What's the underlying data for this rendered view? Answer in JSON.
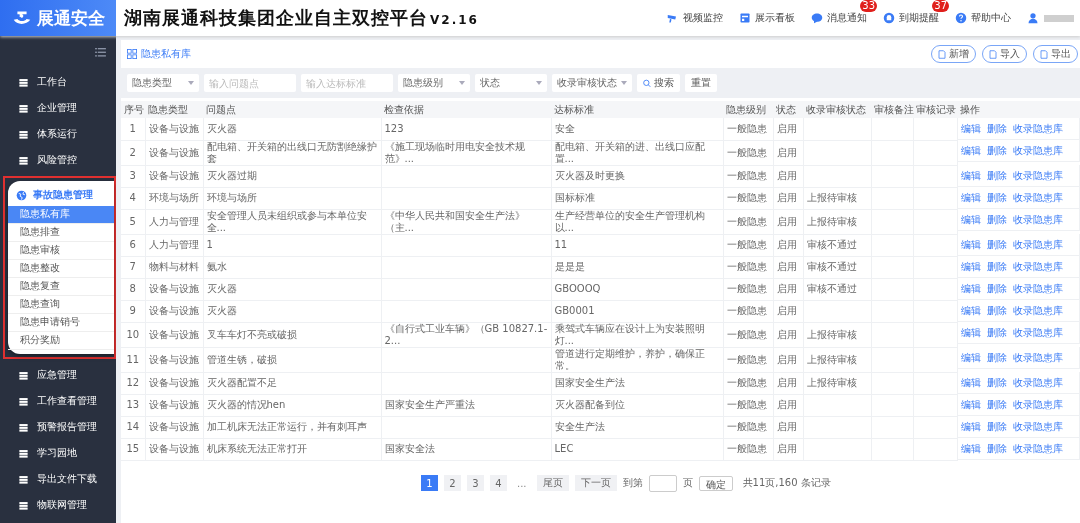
{
  "logo": {
    "text": "展通安全"
  },
  "header": {
    "title": "湖南展通科技集团企业自主双控平台",
    "version": "V2.16",
    "nav": [
      {
        "label": "视频监控"
      },
      {
        "label": "展示看板"
      },
      {
        "label": "消息通知",
        "badge": "33"
      },
      {
        "label": "到期提醒",
        "badge": "37"
      },
      {
        "label": "帮助中心"
      }
    ]
  },
  "sidebar": {
    "items": [
      {
        "label": "工作台"
      },
      {
        "label": "企业管理"
      },
      {
        "label": "体系运行"
      },
      {
        "label": "风险管控"
      },
      {
        "label": "事故隐患管理",
        "expanded": true,
        "children": [
          {
            "label": "隐患私有库",
            "selected": true
          },
          {
            "label": "隐患排查",
            "selected": false
          },
          {
            "label": "隐患审核",
            "selected": false
          },
          {
            "label": "隐患整改",
            "selected": false
          },
          {
            "label": "隐患复查",
            "selected": false
          },
          {
            "label": "隐患查询",
            "selected": false
          },
          {
            "label": "隐患申请销号",
            "selected": false
          },
          {
            "label": "积分奖励",
            "selected": false
          }
        ]
      },
      {
        "label": "应急管理"
      },
      {
        "label": "工作查看管理"
      },
      {
        "label": "预警报告管理"
      },
      {
        "label": "学习园地"
      },
      {
        "label": "导出文件下载"
      },
      {
        "label": "物联网管理"
      }
    ]
  },
  "page": {
    "title": "隐患私有库",
    "buttons": [
      "新增",
      "导入",
      "导出"
    ]
  },
  "filters": [
    {
      "kind": "select",
      "placeholder": "隐患类型"
    },
    {
      "kind": "input",
      "placeholder": "输入问题点"
    },
    {
      "kind": "input",
      "placeholder": "输入达标标准"
    },
    {
      "kind": "select",
      "placeholder": "隐患级别"
    },
    {
      "kind": "select",
      "placeholder": "状态"
    },
    {
      "kind": "select",
      "placeholder": "收录审核状态"
    }
  ],
  "search_button": "搜索",
  "reset_button": "重置",
  "table": {
    "columns": [
      "序号",
      "隐患类型",
      "问题点",
      "检查依据",
      "达标标准",
      "隐患级别",
      "状态",
      "收录审核状态",
      "审核备注",
      "审核记录",
      "操作"
    ],
    "rows": [
      {
        "no": "1",
        "type": "设备与设施",
        "issue": "灭火器",
        "basis": "123",
        "standard": "安全",
        "level": "一般隐患",
        "status": "启用",
        "actions": [
          "编辑",
          "删除",
          "收录隐患库"
        ]
      },
      {
        "no": "2",
        "type": "设备与设施",
        "issue": "配电箱、开关箱的出线口无防割绝缘护套",
        "basis": "《施工现场临时用电安全技术规范》...",
        "standard": "配电箱、开关箱的进、出线口应配置...",
        "level": "一般隐患",
        "status": "启用",
        "actions": [
          "编辑",
          "删除",
          "收录隐患库"
        ]
      },
      {
        "no": "3",
        "type": "设备与设施",
        "issue": "灭火器过期",
        "standard": "灭火器及时更换",
        "level": "一般隐患",
        "status": "启用",
        "actions": [
          "编辑",
          "删除",
          "收录隐患库"
        ]
      },
      {
        "no": "4",
        "type": "环境与场所",
        "issue": "环境与场所",
        "standard": "国标标准",
        "level": "一般隐患",
        "status": "启用",
        "review": "上报待审核",
        "actions": [
          "编辑",
          "删除",
          "收录隐患库"
        ]
      },
      {
        "no": "5",
        "type": "人力与管理",
        "issue": "安全管理人员未组织或参与本单位安全...",
        "basis": "《中华人民共和国安全生产法》（主...",
        "standard": "生产经营单位的安全生产管理机构以...",
        "level": "一般隐患",
        "status": "启用",
        "review": "上报待审核",
        "actions": [
          "编辑",
          "删除",
          "收录隐患库"
        ]
      },
      {
        "no": "6",
        "type": "人力与管理",
        "issue": "1",
        "standard": "11",
        "level": "一般隐患",
        "status": "启用",
        "review": "审核不通过",
        "actions": [
          "编辑",
          "删除",
          "收录隐患库"
        ]
      },
      {
        "no": "7",
        "type": "物料与材料",
        "issue": "氨水",
        "standard": "是是是",
        "level": "一般隐患",
        "status": "启用",
        "review": "审核不通过",
        "actions": [
          "编辑",
          "删除",
          "收录隐患库"
        ]
      },
      {
        "no": "8",
        "type": "设备与设施",
        "issue": "灭火器",
        "standard": "GBOOOQ",
        "level": "一般隐患",
        "status": "启用",
        "review": "审核不通过",
        "actions": [
          "编辑",
          "删除",
          "收录隐患库"
        ]
      },
      {
        "no": "9",
        "type": "设备与设施",
        "issue": "灭火器",
        "standard": "GB0001",
        "level": "一般隐患",
        "status": "启用",
        "actions": [
          "编辑",
          "删除",
          "收录隐患库"
        ]
      },
      {
        "no": "10",
        "type": "设备与设施",
        "issue": "叉车车灯不亮或破损",
        "basis": "《自行式工业车辆》（GB 10827.1-2...",
        "standard": "乘驾式车辆应在设计上为安装照明灯...",
        "level": "一般隐患",
        "status": "启用",
        "review": "上报待审核",
        "actions": [
          "编辑",
          "删除",
          "收录隐患库"
        ]
      },
      {
        "no": "11",
        "type": "设备与设施",
        "issue": "管道生锈，破损",
        "standard": "管道进行定期维护，养护，确保正常。",
        "level": "一般隐患",
        "status": "启用",
        "review": "上报待审核",
        "actions": [
          "编辑",
          "删除",
          "收录隐患库"
        ]
      },
      {
        "no": "12",
        "type": "设备与设施",
        "issue": "灭火器配置不足",
        "standard": "国家安全生产法",
        "level": "一般隐患",
        "status": "启用",
        "review": "上报待审核",
        "actions": [
          "编辑",
          "删除",
          "收录隐患库"
        ]
      },
      {
        "no": "13",
        "type": "设备与设施",
        "issue": "灭火器的情况hen",
        "basis": "国家安全生产严重法",
        "standard": "灭火器配备到位",
        "level": "一般隐患",
        "status": "启用",
        "actions": [
          "编辑",
          "删除",
          "收录隐患库"
        ]
      },
      {
        "no": "14",
        "type": "设备与设施",
        "issue": "加工机床无法正常运行，并有刺耳声",
        "standard": "安全生产法",
        "level": "一般隐患",
        "status": "启用",
        "actions": [
          "编辑",
          "删除",
          "收录隐患库"
        ]
      },
      {
        "no": "15",
        "type": "设备与设施",
        "issue": "机床系统无法正常打开",
        "basis": "国家安全法",
        "standard": "LEC",
        "level": "一般隐患",
        "status": "启用",
        "actions": [
          "编辑",
          "删除",
          "收录隐患库"
        ]
      }
    ]
  },
  "pagination": {
    "pages": [
      {
        "label": "1",
        "selected": true
      },
      {
        "label": "2",
        "selected": false
      },
      {
        "label": "3",
        "selected": false
      },
      {
        "label": "4",
        "selected": false
      }
    ],
    "ellipsis": "...",
    "last": "尾页",
    "next": "下一页",
    "goto_label": "到第",
    "page_unit": "页",
    "confirm": "确定",
    "summary": "共11页,160 条记录"
  }
}
